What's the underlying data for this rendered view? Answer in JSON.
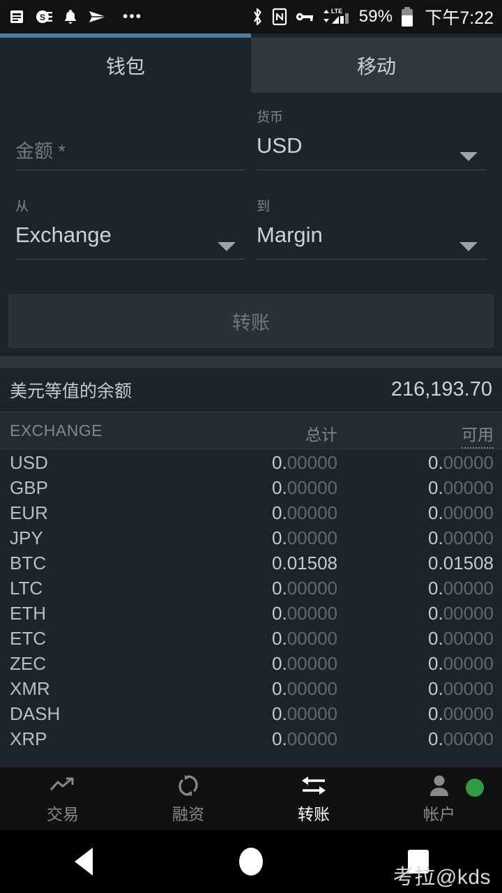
{
  "statusbar": {
    "left_icons": [
      "note-icon",
      "s-badge-icon",
      "bell-icon",
      "telegram-icon",
      "more-dots-icon"
    ],
    "right_icons": [
      "bluetooth-icon",
      "nfc-icon",
      "vpn-key-icon",
      "lte-signal-icon"
    ],
    "lte_label": "LTE",
    "battery_percent": "59%",
    "time": "下午7:22"
  },
  "tabs": {
    "accent_color": "#4a7e9e",
    "items": [
      {
        "label": "钱包",
        "active": false
      },
      {
        "label": "移动",
        "active": true
      }
    ]
  },
  "form": {
    "amount": {
      "label": "",
      "placeholder": "金额 *",
      "value": ""
    },
    "currency": {
      "label": "货币",
      "value": "USD"
    },
    "from": {
      "label": "从",
      "value": "Exchange"
    },
    "to": {
      "label": "到",
      "value": "Margin"
    },
    "transfer_button": "转账"
  },
  "balance": {
    "label": "美元等值的余额",
    "value": "216,193.70"
  },
  "table": {
    "headers": {
      "symbol": "EXCHANGE",
      "total": "总计",
      "available": "可用"
    },
    "sorted_column": "available",
    "rows": [
      {
        "symbol": "USD",
        "total": "0.00000",
        "available": "0.00000",
        "bright": false
      },
      {
        "symbol": "GBP",
        "total": "0.00000",
        "available": "0.00000",
        "bright": false
      },
      {
        "symbol": "EUR",
        "total": "0.00000",
        "available": "0.00000",
        "bright": false
      },
      {
        "symbol": "JPY",
        "total": "0.00000",
        "available": "0.00000",
        "bright": false
      },
      {
        "symbol": "BTC",
        "total": "0.01508",
        "available": "0.01508",
        "bright": true
      },
      {
        "symbol": "LTC",
        "total": "0.00000",
        "available": "0.00000",
        "bright": false
      },
      {
        "symbol": "ETH",
        "total": "0.00000",
        "available": "0.00000",
        "bright": false
      },
      {
        "symbol": "ETC",
        "total": "0.00000",
        "available": "0.00000",
        "bright": false
      },
      {
        "symbol": "ZEC",
        "total": "0.00000",
        "available": "0.00000",
        "bright": false
      },
      {
        "symbol": "XMR",
        "total": "0.00000",
        "available": "0.00000",
        "bright": false
      },
      {
        "symbol": "DASH",
        "total": "0.00000",
        "available": "0.00000",
        "bright": false
      },
      {
        "symbol": "XRP",
        "total": "0.00000",
        "available": "0.00000",
        "bright": false
      }
    ]
  },
  "bottom_nav": {
    "items": [
      {
        "label": "交易",
        "icon": "trending-up-icon",
        "active": false
      },
      {
        "label": "融资",
        "icon": "refresh-icon",
        "active": false
      },
      {
        "label": "转账",
        "icon": "transfer-arrows-icon",
        "active": true
      },
      {
        "label": "帐户",
        "icon": "person-icon",
        "active": false
      }
    ],
    "status_dot_color": "#2e9c3f"
  },
  "system_nav": {
    "back": "back-triangle-icon",
    "home": "home-circle-icon",
    "recents": "recents-square-icon"
  },
  "watermark": "考拉@kds"
}
